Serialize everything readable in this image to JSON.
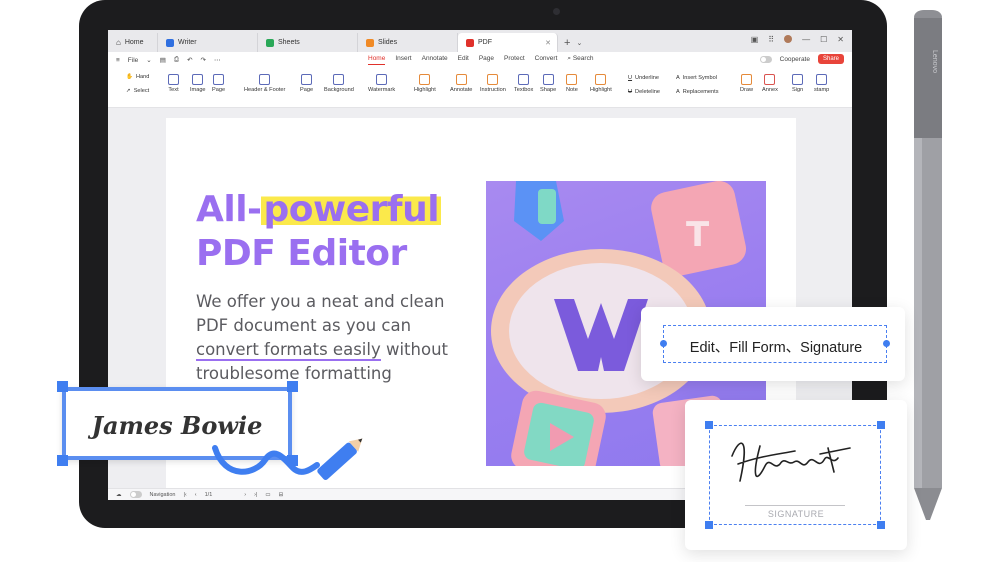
{
  "tabs": [
    {
      "label": "Home",
      "icon": "home-icon"
    },
    {
      "label": "Writer",
      "icon": "writer-icon",
      "color": "#2f6fe0"
    },
    {
      "label": "Sheets",
      "icon": "sheets-icon",
      "color": "#2aa858"
    },
    {
      "label": "Slides",
      "icon": "slides-icon",
      "color": "#f08a26"
    },
    {
      "label": "PDF",
      "icon": "pdf-icon",
      "color": "#e0312b"
    }
  ],
  "menubar": {
    "file_label": "File",
    "tabs": [
      "Home",
      "Insert",
      "Annotate",
      "Edit",
      "Page",
      "Protect",
      "Convert"
    ],
    "active_tab": "Home",
    "search_label": "Search",
    "cooperate_label": "Cooperate",
    "share_label": "Share"
  },
  "ribbon": {
    "hand": "Hand",
    "select": "Select",
    "text": "Text",
    "image": "Image",
    "page": "Page",
    "header_footer": "Header & Footer",
    "page2": "Page",
    "background": "Background",
    "watermark": "Watermark",
    "highlight": "Highlight",
    "annotate": "Annotate",
    "instruction": "Instruction",
    "textbox": "Textbox",
    "shape": "Shape",
    "note": "Note",
    "highlight2": "Highlight",
    "underline": "Underline",
    "deleteline": "Deleteline",
    "insert_symbol": "Insert Symbol",
    "replacements": "Replacements",
    "draw": "Draw",
    "annex": "Annex",
    "sign": "Sign",
    "stamp": "stamp"
  },
  "document": {
    "headline_part1": "All-",
    "headline_highlight": "powerful",
    "headline_line2": "PDF Editor",
    "body_line1": "We offer you a neat and clean",
    "body_line2": "PDF document as you can",
    "body_underlined": "convert formats easily",
    "body_after_underline": " without",
    "body_line4": "troublesome formatting"
  },
  "statusbar": {
    "navigation_label": "Navigation",
    "page_indicator": "1/1"
  },
  "overlays": {
    "name_signature": "James Bowie",
    "edit_features": "Edit、Fill Form、Signature",
    "signature_label": "SIGNATURE",
    "signature_handwriting": "Hartmut"
  },
  "stylus_brand": "Lenovo",
  "colors": {
    "headline_purple": "#9a6ff0",
    "highlight_yellow": "#fbe94b",
    "accent_blue": "#3f7ef0",
    "share_red": "#e8443a",
    "tablet_body": "#1c1c1e"
  }
}
